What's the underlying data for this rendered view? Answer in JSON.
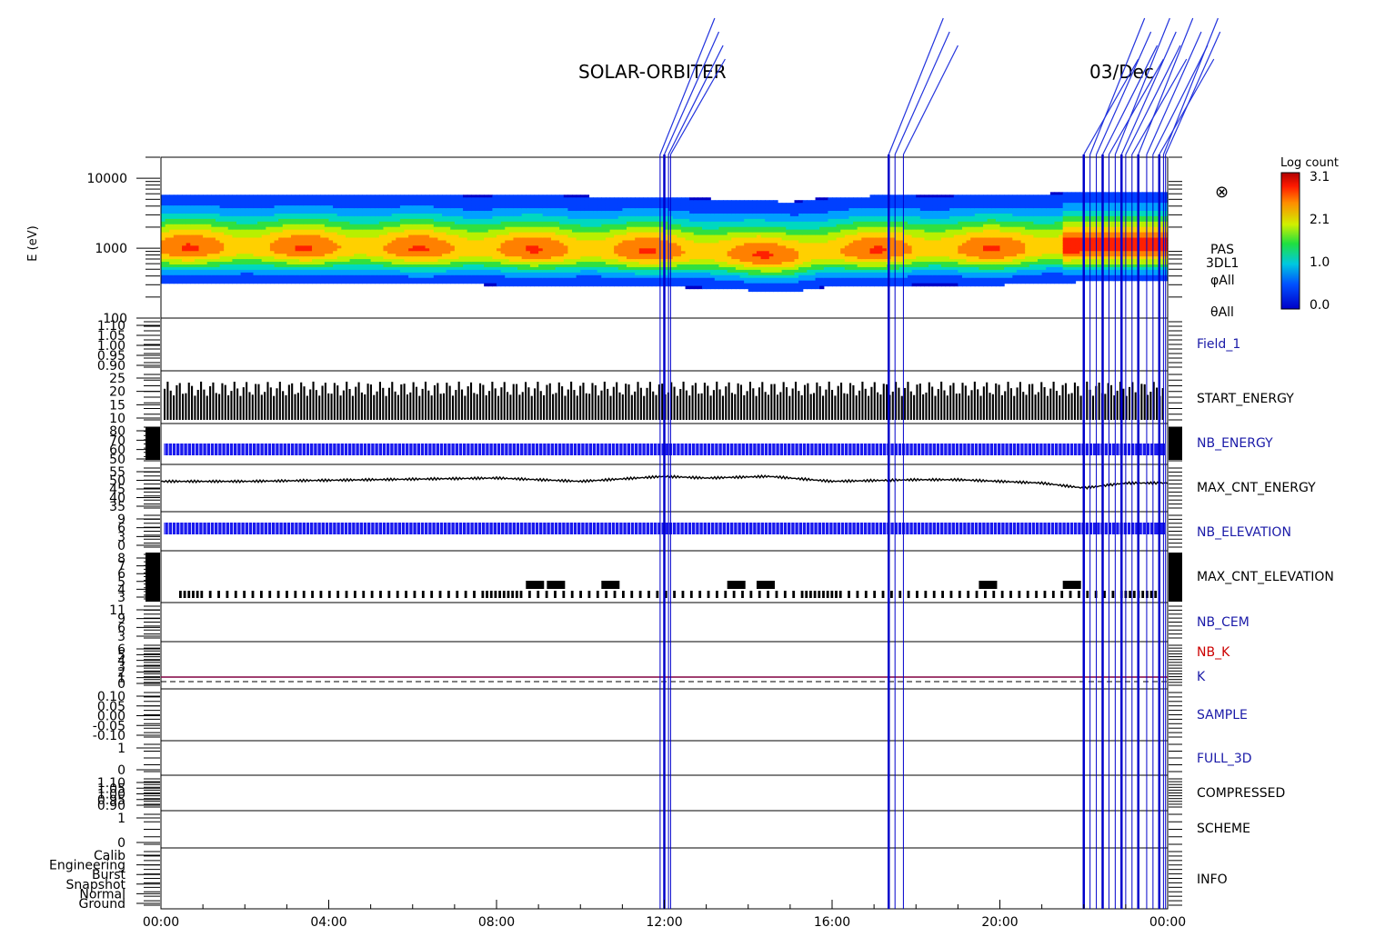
{
  "header": {
    "mission": "SOLAR-ORBITER",
    "date": "03/Dec"
  },
  "colors": {
    "event_blue": "#0000cc",
    "label_black": "#000000",
    "label_blue": "#1a1aa8",
    "label_red": "#cc0000"
  },
  "panels": {
    "spectrogram": {
      "ylabel": "E (eV)",
      "yticks": [
        "10000",
        "1000",
        "100"
      ],
      "side_labels": [
        "PAS",
        "3DL1",
        "φAll",
        "θAll"
      ],
      "colorbar": {
        "title": "Log count",
        "ticks": [
          "3.1",
          "2.1",
          "1.0",
          "0.0"
        ],
        "range": [
          0.0,
          3.1
        ]
      }
    },
    "field_1": {
      "label": "Field_1",
      "ticks": [
        "1.10",
        "1.05",
        "1.00",
        "0.95",
        "0.90"
      ]
    },
    "start_energy": {
      "label": "START_ENERGY",
      "ticks": [
        "25",
        "20",
        "15",
        "10"
      ]
    },
    "nb_energy": {
      "label": "NB_ENERGY",
      "ticks": [
        "80",
        "70",
        "60",
        "50"
      ]
    },
    "max_cnt_energy": {
      "label": "MAX_CNT_ENERGY",
      "ticks": [
        "55",
        "50",
        "45",
        "40",
        "35"
      ]
    },
    "nb_elevation": {
      "label": "NB_ELEVATION",
      "ticks": [
        "9",
        "6",
        "3",
        "0"
      ]
    },
    "max_cnt_elevation": {
      "label": "MAX_CNT_ELEVATION",
      "ticks": [
        "8",
        "7",
        "6",
        "5",
        "4",
        "3"
      ]
    },
    "nb_cem": {
      "label": "NB_CEM",
      "ticks": [
        "11",
        "9",
        "6",
        "3"
      ]
    },
    "nb_k": {
      "label": "NB_K",
      "label2": "K",
      "ticks": [
        "6",
        "5",
        "4",
        "3",
        "2",
        "1",
        "0"
      ]
    },
    "sample": {
      "label": "SAMPLE",
      "ticks": [
        "0.10",
        "0.05",
        "0.00",
        "-0.05",
        "-0.10"
      ]
    },
    "full_3d": {
      "label": "FULL_3D",
      "ticks": [
        "1",
        "0"
      ]
    },
    "compressed": {
      "label": "COMPRESSED",
      "ticks": [
        "1.10",
        "1.05",
        "1.00",
        "0.95",
        "0.90"
      ]
    },
    "scheme": {
      "label": "SCHEME",
      "ticks": [
        "1",
        "0"
      ]
    },
    "info": {
      "label": "INFO",
      "ticks": [
        "Calib",
        "Engineering",
        "Burst",
        "Snapshot",
        "Normal",
        "Ground"
      ]
    }
  },
  "x_axis": {
    "ticks": [
      "00:00",
      "04:00",
      "08:00",
      "12:00",
      "16:00",
      "20:00",
      "00:00"
    ]
  },
  "chart_data": {
    "type": "heatmap",
    "title": "SOLAR-ORBITER 03/Dec",
    "x_range_hours": [
      0,
      24
    ],
    "energy_range_ev": [
      100,
      20000
    ],
    "y_scale": "log",
    "colorbar_label": "Log count",
    "colorbar_range": [
      0.0,
      3.1
    ],
    "peak_energy_ev": [
      [
        0,
        1000
      ],
      [
        4,
        1000
      ],
      [
        8,
        950
      ],
      [
        12,
        900
      ],
      [
        14,
        800
      ],
      [
        15,
        760
      ],
      [
        16,
        900
      ],
      [
        18,
        950
      ],
      [
        20,
        950
      ],
      [
        22,
        1050
      ],
      [
        24,
        1050
      ]
    ],
    "time_series": {
      "start_energy_range": [
        18,
        24
      ],
      "nb_energy_value": 60,
      "max_cnt_energy": [
        [
          0,
          49
        ],
        [
          2,
          49
        ],
        [
          5,
          50
        ],
        [
          8,
          51
        ],
        [
          10,
          49
        ],
        [
          12,
          52
        ],
        [
          13,
          51
        ],
        [
          14.5,
          52
        ],
        [
          16,
          49
        ],
        [
          18,
          50
        ],
        [
          19,
          50
        ],
        [
          21,
          48
        ],
        [
          22,
          45
        ],
        [
          23,
          48
        ],
        [
          24,
          48
        ]
      ],
      "nb_elevation_value": 6,
      "nb_k_value": 0.5
    },
    "event_times_hours": [
      11.9,
      12.0,
      12.1,
      12.15,
      17.35,
      17.5,
      17.7,
      22.0,
      22.15,
      22.3,
      22.45,
      22.6,
      22.75,
      22.9,
      23.0,
      23.15,
      23.3,
      23.5,
      23.65,
      23.8,
      23.9,
      23.95
    ]
  }
}
